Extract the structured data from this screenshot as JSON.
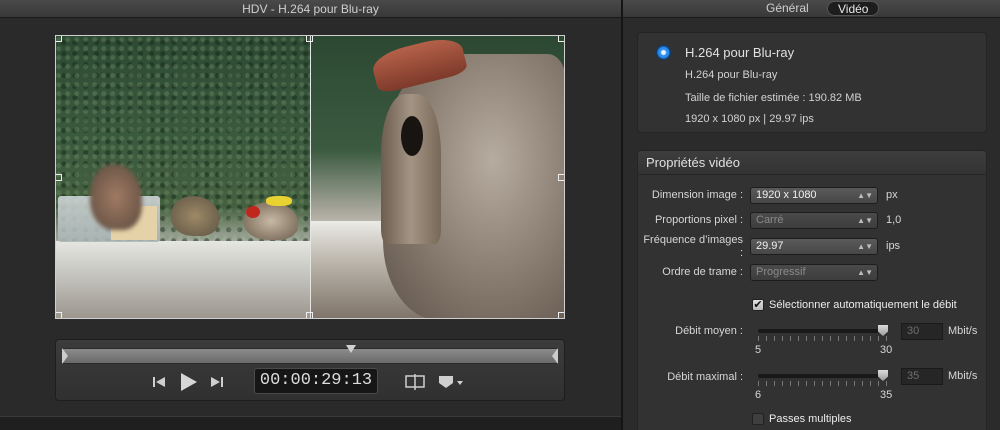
{
  "viewer": {
    "title": "HDV - H.264 pour Blu-ray",
    "timecode": "00:00:29:13"
  },
  "tabs": [
    {
      "label": "Général",
      "selected": false
    },
    {
      "label": "Vidéo",
      "selected": true
    }
  ],
  "summary": {
    "title": "H.264 pour Blu-ray",
    "line1": "H.264 pour Blu-ray",
    "line2": "Taille de fichier estimée : 190.82 MB",
    "line3": "1920 x 1080 px | 29.97 ips"
  },
  "props": {
    "header": "Propriétés vidéo",
    "dimension": {
      "label": "Dimension image :",
      "value": "1920 x 1080",
      "unit": "px"
    },
    "pixel_ratio": {
      "label": "Proportions pixel :",
      "value": "Carré",
      "unit": "1,0"
    },
    "framerate": {
      "label": "Fréquence d’images :",
      "value": "29.97",
      "unit": "ips"
    },
    "field_order": {
      "label": "Ordre de trame :",
      "value": "Progressif"
    },
    "auto_bitrate": {
      "label": "Sélectionner automatiquement le débit",
      "checked": true
    },
    "avg_bitrate": {
      "label": "Débit moyen :",
      "value": "30",
      "unit": "Mbit/s",
      "min": "5",
      "max": "30",
      "level": 1.0
    },
    "max_bitrate": {
      "label": "Débit maximal :",
      "value": "35",
      "unit": "Mbit/s",
      "min": "6",
      "max": "35",
      "level": 1.0
    },
    "multipass": {
      "label": "Passes multiples",
      "checked": false
    }
  },
  "icons": {
    "preset": "compressor-preset-icon",
    "prev": "skip-back-icon",
    "play": "play-icon",
    "next": "skip-forward-icon",
    "compare": "split-view-icon",
    "marker": "marker-menu-icon"
  },
  "colors": {
    "accent": "#2f8ef0",
    "bird_red": "#c0261c",
    "bird_yellow": "#e8d232"
  }
}
